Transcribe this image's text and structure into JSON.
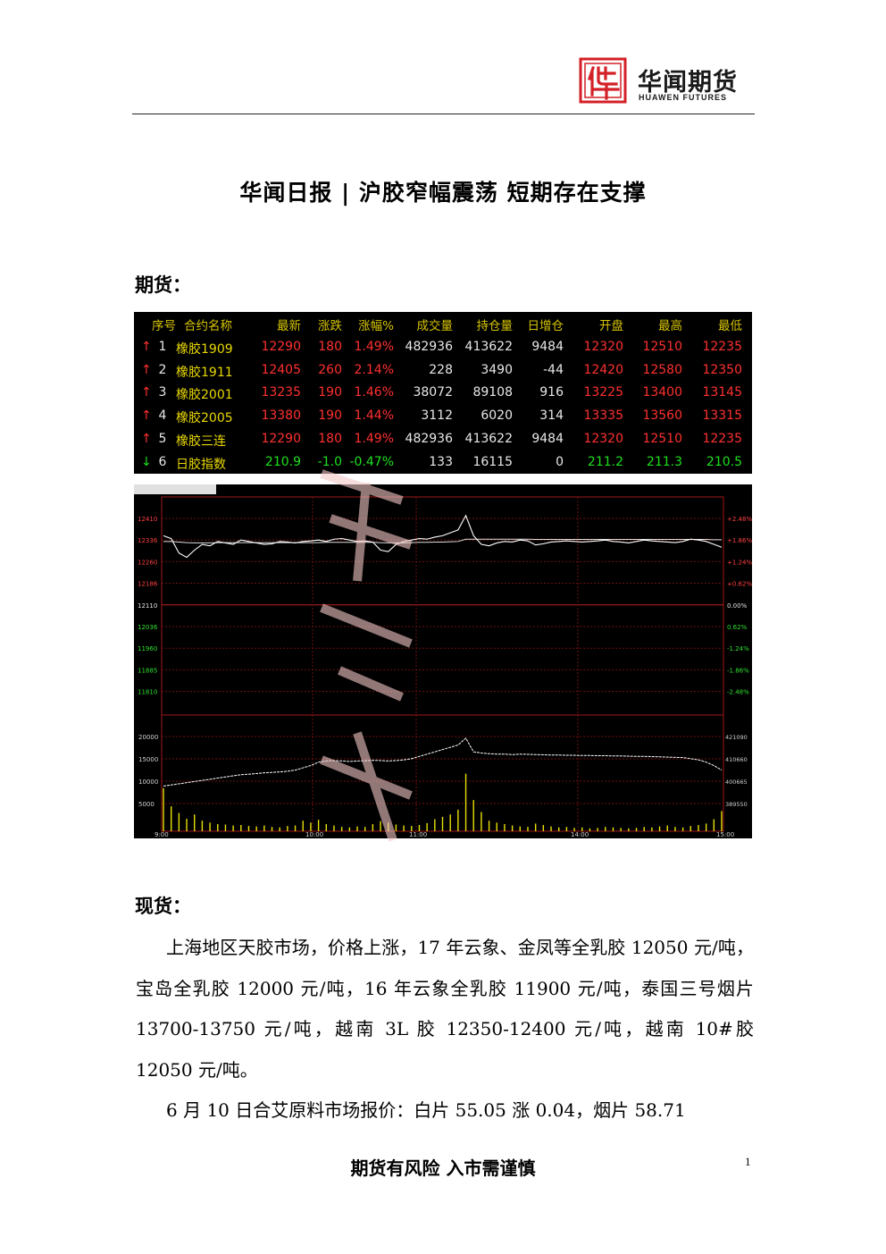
{
  "header": {
    "logo_cn": "华闻期货",
    "logo_en": "HUAWEN FUTURES",
    "logo_color": "#d42027"
  },
  "title": "华闻日报 | 沪胶窄幅震荡 短期存在支撑",
  "sections": {
    "futures": "期货：",
    "spot": "现货："
  },
  "quote_table": {
    "headers": [
      "序号",
      "合约名称",
      "最新",
      "涨跌",
      "涨幅%",
      "成交量",
      "持仓量",
      "日增仓",
      "开盘",
      "最高",
      "最低"
    ],
    "rows": [
      {
        "dir": "up",
        "arrow": "↑",
        "no": "1",
        "name": "橡胶1909",
        "last": "12290",
        "chg": "180",
        "pct": "1.49%",
        "vol": "482936",
        "oi": "413622",
        "oi_chg": "9484",
        "open": "12320",
        "high": "12510",
        "low": "12235"
      },
      {
        "dir": "up",
        "arrow": "↑",
        "no": "2",
        "name": "橡胶1911",
        "last": "12405",
        "chg": "260",
        "pct": "2.14%",
        "vol": "228",
        "oi": "3490",
        "oi_chg": "-44",
        "open": "12420",
        "high": "12580",
        "low": "12350"
      },
      {
        "dir": "up",
        "arrow": "↑",
        "no": "3",
        "name": "橡胶2001",
        "last": "13235",
        "chg": "190",
        "pct": "1.46%",
        "vol": "38072",
        "oi": "89108",
        "oi_chg": "916",
        "open": "13225",
        "high": "13400",
        "low": "13145"
      },
      {
        "dir": "up",
        "arrow": "↑",
        "no": "4",
        "name": "橡胶2005",
        "last": "13380",
        "chg": "190",
        "pct": "1.44%",
        "vol": "3112",
        "oi": "6020",
        "oi_chg": "314",
        "open": "13335",
        "high": "13560",
        "low": "13315"
      },
      {
        "dir": "up",
        "arrow": "↑",
        "no": "5",
        "name": "橡胶三连",
        "last": "12290",
        "chg": "180",
        "pct": "1.49%",
        "vol": "482936",
        "oi": "413622",
        "oi_chg": "9484",
        "open": "12320",
        "high": "12510",
        "low": "12235"
      },
      {
        "dir": "down",
        "arrow": "↓",
        "no": "6",
        "name": "日胶指数",
        "last": "210.9",
        "chg": "-1.0",
        "pct": "-0.47%",
        "vol": "133",
        "oi": "16115",
        "oi_chg": "0",
        "open": "211.2",
        "high": "211.3",
        "low": "210.5"
      }
    ]
  },
  "chart_data": {
    "type": "line",
    "price_ticks": [
      "12410",
      "12336",
      "12260",
      "12186",
      "12110",
      "12036",
      "11960",
      "11885",
      "11810"
    ],
    "pct_ticks": [
      "+2.48%",
      "+1.86%",
      "+1.24%",
      "+0.62%",
      "0.00%",
      "0.62%",
      "-1.24%",
      "-1.86%",
      "-2.48%"
    ],
    "volume_ticks": [
      "20000",
      "15000",
      "10000",
      "5000"
    ],
    "oi_ticks": [
      "421090",
      "410660",
      "400665",
      "389550"
    ],
    "time_labels": [
      "9:00",
      "10:00",
      "11:00",
      "14:00",
      "15:00"
    ],
    "price": [
      12350,
      12340,
      12290,
      12275,
      12300,
      12320,
      12315,
      12330,
      12325,
      12320,
      12335,
      12330,
      12325,
      12320,
      12322,
      12330,
      12328,
      12325,
      12330,
      12332,
      12335,
      12330,
      12338,
      12340,
      12335,
      12330,
      12332,
      12328,
      12300,
      12295,
      12320,
      12330,
      12335,
      12340,
      12338,
      12345,
      12350,
      12360,
      12370,
      12420,
      12350,
      12320,
      12315,
      12325,
      12330,
      12328,
      12335,
      12332,
      12318,
      12322,
      12328,
      12330,
      12332,
      12330,
      12328,
      12330,
      12332,
      12335,
      12330,
      12328,
      12325,
      12330,
      12335,
      12332,
      12330,
      12328,
      12326,
      12330,
      12338,
      12335,
      12330,
      12320,
      12310
    ],
    "avg_price": [
      12330,
      12330,
      12328,
      12326,
      12325,
      12325,
      12325,
      12326,
      12326,
      12326,
      12326,
      12326,
      12326,
      12326,
      12326,
      12326,
      12326,
      12326,
      12326,
      12326,
      12326,
      12327,
      12327,
      12327,
      12327,
      12327,
      12327,
      12327,
      12326,
      12325,
      12325,
      12325,
      12326,
      12327,
      12327,
      12328,
      12328,
      12329,
      12330,
      12338,
      12338,
      12338,
      12338,
      12338,
      12338,
      12338,
      12338,
      12338,
      12337,
      12337,
      12337,
      12337,
      12337,
      12337,
      12337,
      12337,
      12337,
      12337,
      12337,
      12337,
      12337,
      12337,
      12337,
      12337,
      12337,
      12337,
      12337,
      12337,
      12337,
      12337,
      12337,
      12336,
      12336
    ],
    "open_interest": [
      404000,
      404500,
      405000,
      405500,
      406000,
      406500,
      407000,
      407500,
      408000,
      408500,
      409000,
      409200,
      409500,
      409800,
      410000,
      410200,
      410500,
      411000,
      412000,
      413000,
      414500,
      415000,
      415200,
      415000,
      414800,
      415000,
      415100,
      415300,
      415200,
      415000,
      415200,
      415500,
      416000,
      417000,
      418000,
      419000,
      420000,
      421000,
      422000,
      425000,
      419000,
      418500,
      418200,
      418000,
      418000,
      417800,
      418000,
      417900,
      417800,
      417700,
      417600,
      417600,
      417500,
      417500,
      417400,
      417400,
      417300,
      417300,
      417200,
      417200,
      417100,
      417000,
      417000,
      416900,
      416800,
      416700,
      416600,
      416500,
      416000,
      415500,
      414500,
      413000,
      411000
    ],
    "volume": [
      9000,
      5200,
      3800,
      2600,
      3500,
      2200,
      1800,
      1500,
      1400,
      1200,
      1300,
      1100,
      1000,
      1200,
      900,
      800,
      1100,
      1200,
      2200,
      1800,
      2400,
      1500,
      1200,
      900,
      800,
      1000,
      900,
      1500,
      2100,
      1800,
      1400,
      1200,
      1100,
      1300,
      1700,
      2500,
      3000,
      3500,
      4500,
      12000,
      6500,
      4000,
      2200,
      1800,
      1500,
      1200,
      1000,
      900,
      1600,
      1300,
      1000,
      800,
      900,
      700,
      800,
      600,
      700,
      900,
      800,
      700,
      600,
      700,
      900,
      800,
      1000,
      1200,
      900,
      800,
      1100,
      1300,
      1600,
      2500,
      4200
    ]
  },
  "paragraphs": [
    "上海地区天胶市场，价格上涨，17 年云象、金凤等全乳胶 12050 元/吨，宝岛全乳胶 12000 元/吨，16 年云象全乳胶 11900 元/吨，泰国三号烟片 13700-13750 元/吨，越南 3L 胶 12350-12400 元/吨，越南 10#胶 12050 元/吨。",
    "6 月 10 日合艾原料市场报价：白片 55.05 涨 0.04，烟片 58.71"
  ],
  "footer": "期货有风险 入市需谨慎",
  "page_number": "1"
}
